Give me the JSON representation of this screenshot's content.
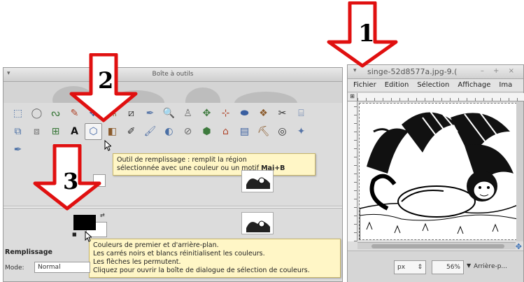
{
  "toolbox": {
    "title": "Boîte à outils",
    "tools_row1": [
      "⬚",
      "◯",
      "ᔓ",
      "✎",
      "✥",
      "⚗",
      "⧄",
      "✒",
      "🔍",
      "♙",
      "✥",
      "⊹",
      "⬬",
      "❖",
      "✂",
      "⌸"
    ],
    "tools_row2": [
      "⧉",
      "⧈",
      "⊞",
      "A",
      "⬡",
      "◧",
      "✐",
      "🖌",
      "◐",
      "⊘",
      "⬢",
      "⌂",
      "▤",
      "⛏",
      "◎",
      "✦"
    ],
    "tools_row3": [
      "✒"
    ],
    "active_tool": "Remplissage",
    "tooltip_fill": {
      "line1": "Outil de remplissage : remplit la région",
      "line2": "sélectionnée avec une couleur ou un motif",
      "shortcut": "Maj+B"
    },
    "tooltip_colors": {
      "line1": "Couleurs de premier et d'arrière-plan.",
      "line2": "Les carrés noirs et blancs réinitialisent les couleurs.",
      "line3": "Les flèches les permutent.",
      "line4": "Cliquez pour ouvrir la boîte de dialogue de sélection de couleurs."
    },
    "options_title": "Remplissage",
    "mode_label": "Mode:",
    "mode_value": "Normal"
  },
  "image_window": {
    "title": "singe-52d8577a.jpg-9.(",
    "window_buttons": "– + ×",
    "menus": [
      "Fichier",
      "Edition",
      "Sélection",
      "Affichage",
      "Ima"
    ],
    "unit": "px",
    "zoom": "56%",
    "status": "Arrière-p..."
  },
  "callouts": {
    "one": "1",
    "two": "2",
    "three": "3"
  },
  "colors": {
    "arrow_fill": "#ffffff",
    "arrow_stroke": "#e01010",
    "tooltip_bg": "#fff6c6"
  }
}
